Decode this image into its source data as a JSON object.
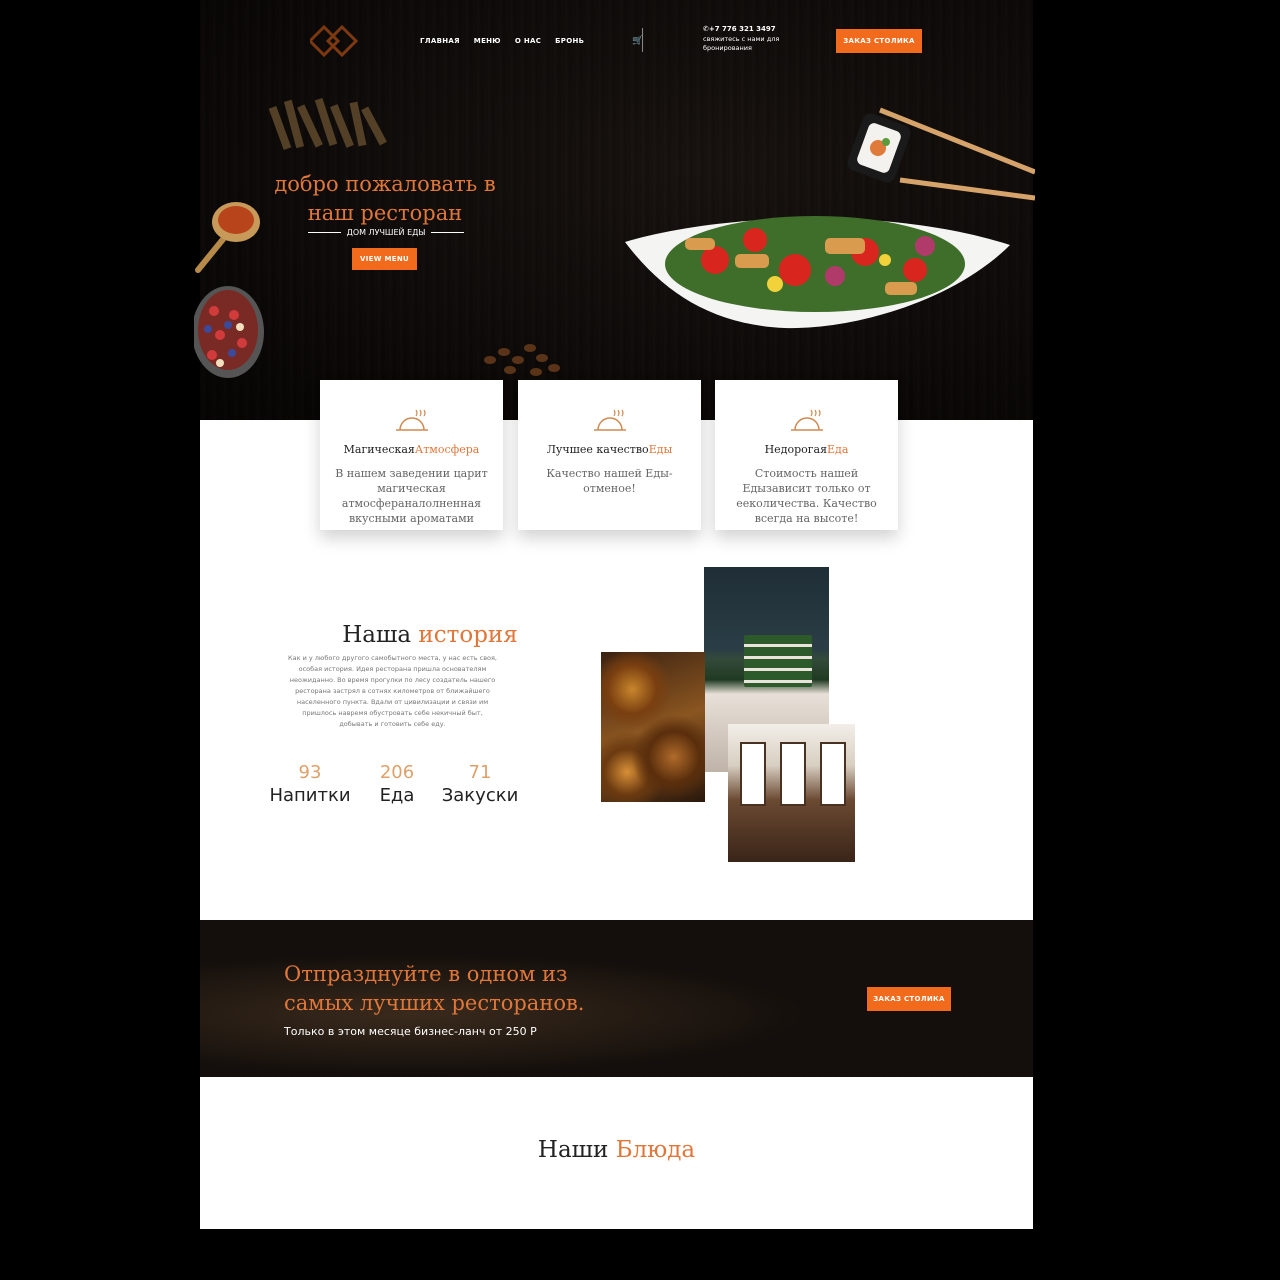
{
  "header": {
    "nav": [
      "ГЛАВНАЯ",
      "МЕНЮ",
      "О НАС",
      "БРОНЬ"
    ],
    "phone": "+7 776 321 3497",
    "contact_sub": "свяжитесь с нами для бронирования",
    "reserve_button": "ЗАКАЗ СТОЛИКА",
    "icons": [
      "logo-icon",
      "cart-icon",
      "phone-icon"
    ]
  },
  "hero": {
    "title_line1": "добро пожаловать в",
    "title_line2": "наш ресторан",
    "subtitle": "ДОМ ЛУЧШЕЙ ЕДЫ",
    "button": "VIEW MENU"
  },
  "features": [
    {
      "title_a": "Магическая",
      "title_b": "Атмосфера",
      "text": "В нашем заведении царит магическая атмосфераналолненная вкусными ароматами"
    },
    {
      "title_a": "Лучшее качество",
      "title_b": "Еды",
      "text": "Качество нашей Еды-отменое!"
    },
    {
      "title_a": "Недорогая",
      "title_b": "Еда",
      "text": "Стоимость нашей Едызависит только от ееколичества. Качество всегда на высоте!"
    }
  ],
  "story": {
    "title_a": "Наша",
    "title_b": "история",
    "text": "Как и у любого другого самобытного места, у нас есть своя, особая история. Идея ресторана пришла основателям неожиданно. Во время прогулки по лесу создатель нашего ресторана застрял в сотнях километров от ближайшего населенного пункта. Вдали от цивилизации и связи им пришлось навремя обустровать себе некичный быт, добывать и готовить себе еду.",
    "stats": [
      {
        "number": "93",
        "label": "Напитки"
      },
      {
        "number": "206",
        "label": "Еда"
      },
      {
        "number": "71",
        "label": "Закуски"
      }
    ]
  },
  "promo": {
    "title_line1": "Отпразднуйте в одном из",
    "title_line2": "самых лучших ресторанов.",
    "subtitle": "Только в этом месяце бизнес-ланч от 250 Р",
    "button": "ЗАКАЗ СТОЛИКА"
  },
  "dishes": {
    "title_a": "Наши",
    "title_b": "Блюда"
  },
  "colors": {
    "accent": "#f26a1b",
    "accent_text": "#e0773a",
    "dark_bg": "#0e0b0a"
  }
}
